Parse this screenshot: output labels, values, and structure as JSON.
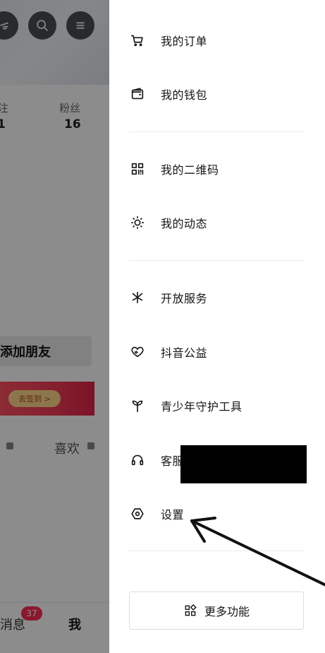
{
  "background": {
    "stats": [
      {
        "label": "注",
        "value": "1"
      },
      {
        "label": "粉丝",
        "value": "16"
      }
    ],
    "add_friend_label": "添加朋友",
    "sign_in_label": "去签到 >",
    "tabs": [
      "",
      "喜欢"
    ],
    "bottom_nav": {
      "messages_label": "消息",
      "messages_badge": "37",
      "me_label": "我"
    }
  },
  "drawer": {
    "groups": [
      {
        "items": [
          {
            "label": "我的订单",
            "icon": "cart-icon"
          },
          {
            "label": "我的钱包",
            "icon": "wallet-icon"
          }
        ]
      },
      {
        "items": [
          {
            "label": "我的二维码",
            "icon": "qr-code-icon"
          },
          {
            "label": "我的动态",
            "icon": "activity-icon"
          }
        ]
      },
      {
        "items": [
          {
            "label": "开放服务",
            "icon": "open-service-icon"
          },
          {
            "label": "抖音公益",
            "icon": "charity-heart-icon"
          },
          {
            "label": "青少年守护工具",
            "icon": "sprout-icon"
          },
          {
            "label": "客服",
            "icon": "headset-icon"
          },
          {
            "label": "设置",
            "icon": "settings-hexagon-icon"
          }
        ]
      }
    ],
    "more_button_label": "更多功能"
  },
  "colors": {
    "badge": "#fe2c55",
    "banner": "#f03a55",
    "text": "#161616",
    "scrim": "rgba(0,0,0,0.45)"
  }
}
